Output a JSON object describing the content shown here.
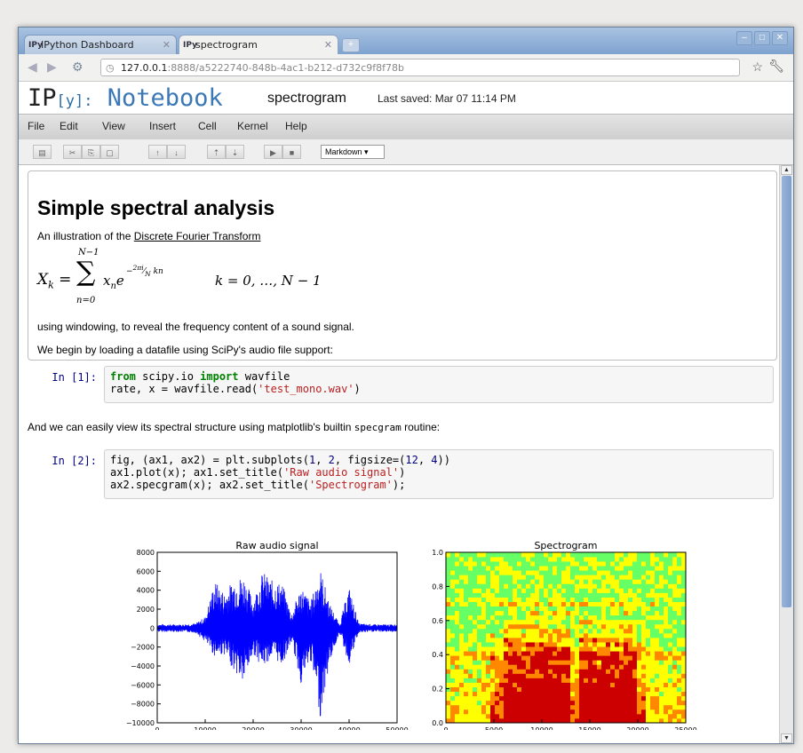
{
  "browser": {
    "tabs": [
      {
        "icon": "IPy",
        "label": "IPython Dashboard"
      },
      {
        "icon": "IPy",
        "label": "spectrogram"
      }
    ],
    "url_host": "127.0.0.1",
    "url_path": ":8888/a5222740-848b-4ac1-b212-d732c9f8f78b"
  },
  "header": {
    "logo_ip": "IP",
    "logo_y": "[y]:",
    "logo_nb": "Notebook",
    "notebook_name": "spectrogram",
    "last_saved": "Last saved: Mar 07 11:14 PM"
  },
  "menu": [
    "File",
    "Edit",
    "View",
    "Insert",
    "Cell",
    "Kernel",
    "Help"
  ],
  "toolbar": {
    "cell_type": "Markdown ▾"
  },
  "markdown": {
    "title": "Simple spectral analysis",
    "intro_prefix": "An illustration of the ",
    "intro_link": "Discrete Fourier Transform",
    "after_math": "using windowing, to reveal the frequency content of a sound signal.",
    "load_text": "We begin by loading a datafile using SciPy's audio file support:"
  },
  "cells": {
    "in1_prompt": "In [1]:",
    "in2_prompt": "In [2]:",
    "mid_prefix": "And we can easily view its spectral structure using matplotlib's builtin ",
    "mid_code": "specgram",
    "mid_suffix": " routine:"
  },
  "chart_data": [
    {
      "type": "line",
      "title": "Raw audio signal",
      "xlabel": "",
      "ylabel": "",
      "xlim": [
        0,
        50000
      ],
      "ylim": [
        -10000,
        8000
      ],
      "xticks": [
        0,
        10000,
        20000,
        30000,
        40000,
        50000
      ],
      "yticks": [
        -10000,
        -8000,
        -6000,
        -4000,
        -2000,
        0,
        2000,
        4000,
        6000,
        8000
      ],
      "color": "#0000ff",
      "envelope": {
        "x": [
          0,
          5000,
          8000,
          10000,
          12000,
          14000,
          16000,
          18000,
          20000,
          22000,
          24000,
          26000,
          28000,
          30000,
          32000,
          34000,
          36000,
          38000,
          40000,
          42000,
          45000,
          50000
        ],
        "upper": [
          400,
          400,
          500,
          1200,
          5000,
          3800,
          5200,
          5600,
          3000,
          6000,
          5000,
          4800,
          1500,
          4500,
          2800,
          6300,
          2500,
          400,
          4400,
          500,
          400,
          400
        ],
        "lower": [
          -400,
          -400,
          -500,
          -1500,
          -3000,
          -2800,
          -4500,
          -6000,
          -2700,
          -4200,
          -3000,
          -4000,
          -1500,
          -6000,
          -3500,
          -9500,
          -3500,
          -500,
          -4000,
          -500,
          -400,
          -400
        ]
      }
    },
    {
      "type": "heatmap",
      "title": "Spectrogram",
      "xlim": [
        0,
        25000
      ],
      "ylim": [
        0.0,
        1.0
      ],
      "xticks": [
        0,
        5000,
        10000,
        15000,
        20000,
        25000
      ],
      "yticks": [
        0.0,
        0.2,
        0.4,
        0.6,
        0.8,
        1.0
      ],
      "colormap": [
        "#0000aa",
        "#00ccff",
        "#66ff66",
        "#ffff00",
        "#ff8800",
        "#cc0000"
      ]
    }
  ]
}
